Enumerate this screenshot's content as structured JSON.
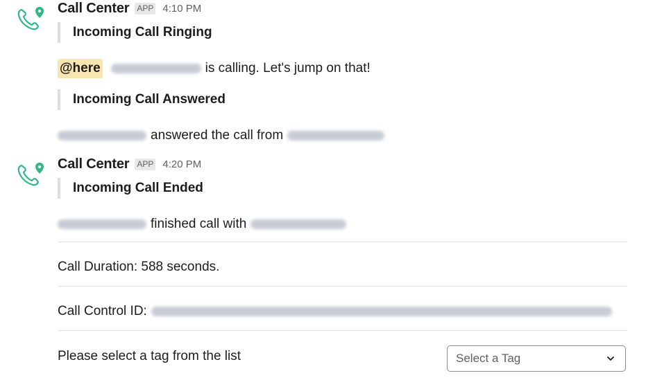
{
  "messages": [
    {
      "sender": "Call Center",
      "badge": "APP",
      "time": "4:10 PM",
      "ringing_title": "Incoming Call Ringing",
      "mention": "@here",
      "calling_text": "is calling. Let's jump on that!",
      "answered_title": "Incoming Call Answered",
      "answered_text": "answered the call from"
    },
    {
      "sender": "Call Center",
      "badge": "APP",
      "time": "4:20 PM",
      "ended_title": "Incoming Call Ended",
      "finished_text": "finished call with",
      "duration_text": "Call Duration: 588 seconds.",
      "control_id_label": "Call Control ID:",
      "tag_prompt": "Please select a tag from the list",
      "tag_select_placeholder": "Select a Tag"
    }
  ],
  "colors": {
    "icon_green": "#2eb886",
    "mention_bg": "#f8e5b0"
  },
  "icons": {
    "avatar": "phone-pin-icon",
    "dropdown": "chevron-down-icon"
  }
}
